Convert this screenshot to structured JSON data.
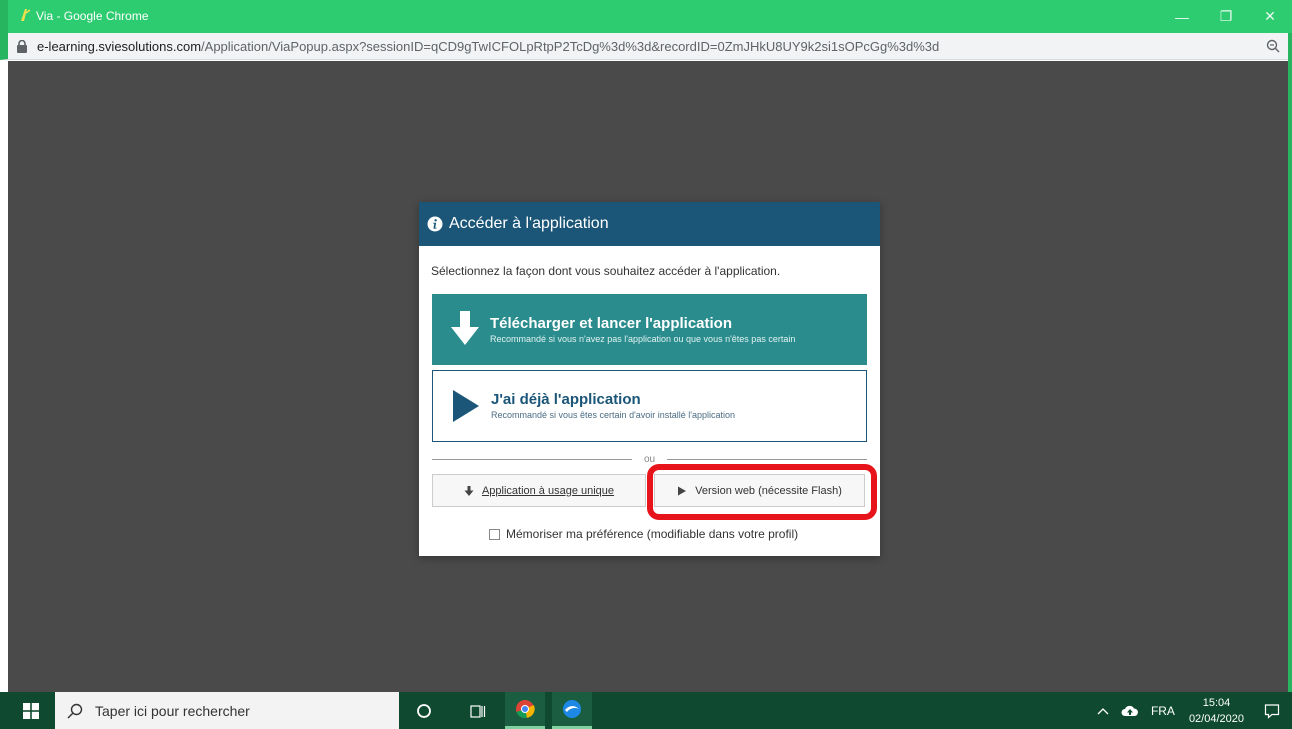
{
  "window": {
    "title": "Via - Google Chrome",
    "controls": {
      "minimize": "—",
      "restore": "❐",
      "close": "✕"
    }
  },
  "address_bar": {
    "domain": "e-learning.sviesolutions.com",
    "path": "/Application/ViaPopup.aspx?sessionID=qCD9gTwICFOLpRtpP2TcDg%3d%3d&recordID=0ZmJHkU8UY9k2si1sOPcGg%3d%3d"
  },
  "dialog": {
    "title": "Accéder à l'application",
    "subtitle": "Sélectionnez la façon dont vous souhaitez accéder à l'application.",
    "primary_option": {
      "title": "Télécharger et lancer l'application",
      "description": "Recommandé si vous n'avez pas l'application ou que vous n'êtes pas certain",
      "icon": "download-arrow-icon"
    },
    "secondary_option": {
      "title": "J'ai déjà l'application",
      "description": "Recommandé si vous êtes certain d'avoir installé l'application",
      "icon": "play-icon"
    },
    "divider_label": "ou",
    "single_use_button": "Application à usage unique",
    "web_version_button": "Version web (nécessite Flash)",
    "remember_label": "Mémoriser ma préférence (modifiable dans votre profil)",
    "remember_checked": false
  },
  "taskbar": {
    "search_placeholder": "Taper ici pour rechercher",
    "language": "FRA",
    "time": "15:04",
    "date": "02/04/2020"
  },
  "colors": {
    "titlebar": "#2ecc71",
    "dialog_header": "#1b5678",
    "primary_option": "#2a8c8c",
    "highlight": "#e8141c",
    "taskbar": "#0f4a30"
  }
}
